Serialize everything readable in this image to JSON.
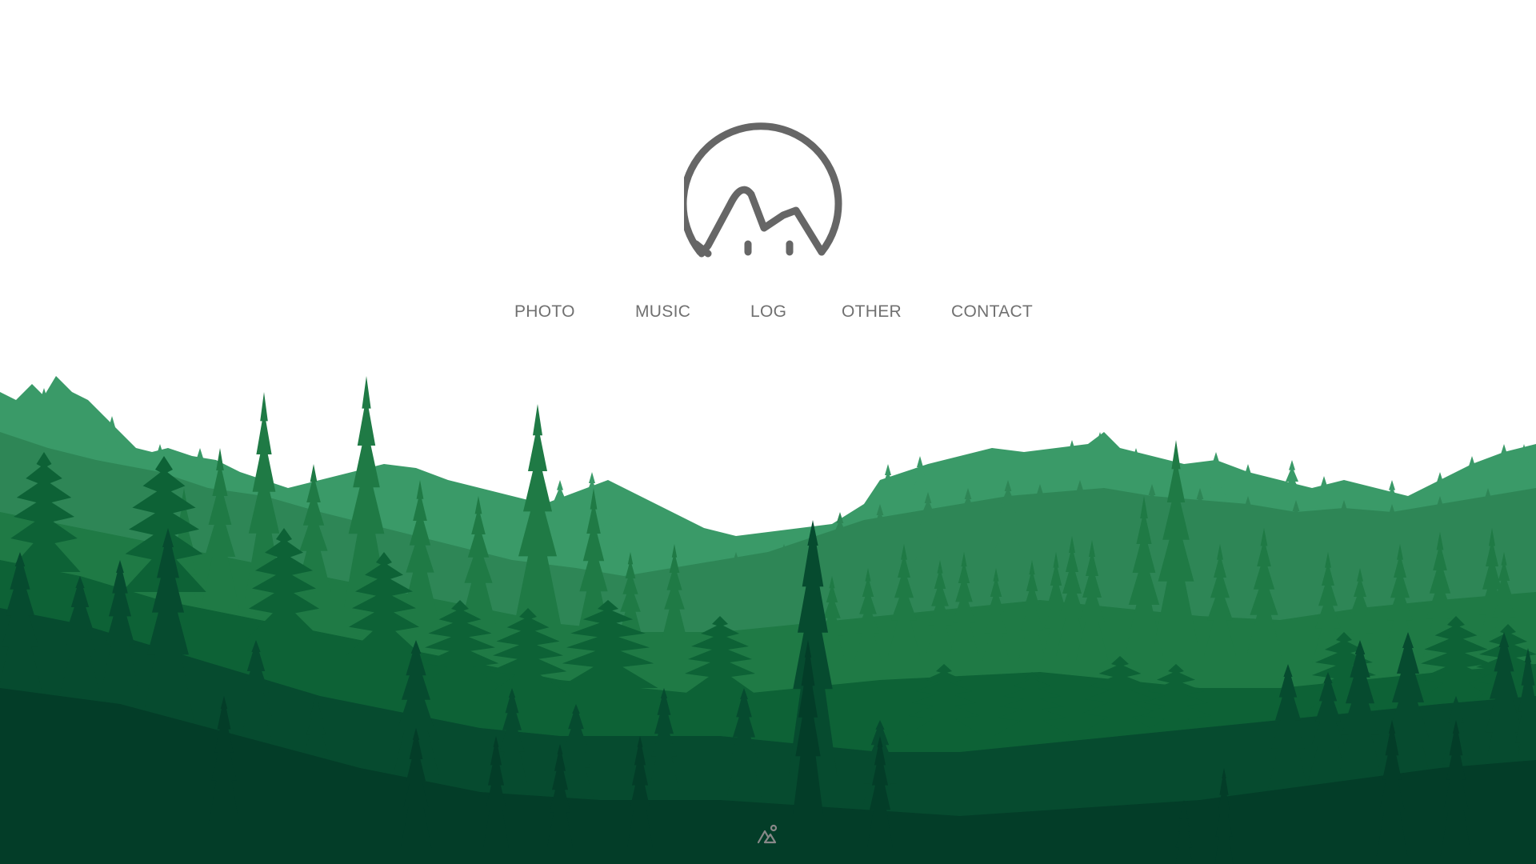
{
  "brand": {
    "logo_icon": "mountain-circle-logo-icon",
    "logo_color": "#666666"
  },
  "nav": {
    "items": [
      {
        "label": "PHOTO"
      },
      {
        "label": "MUSIC"
      },
      {
        "label": "LOG"
      },
      {
        "label": "OTHER"
      },
      {
        "label": "CONTACT"
      }
    ],
    "text_color": "#707070"
  },
  "forest": {
    "colors": {
      "light": "#3a9a68",
      "mid_light": "#2e8656",
      "mid": "#1f7a45",
      "mid_dark": "#0d6236",
      "dark": "#064b2f",
      "darkest": "#033d28"
    }
  },
  "footer": {
    "icon": "mountain-person-icon",
    "icon_color": "#888888"
  }
}
